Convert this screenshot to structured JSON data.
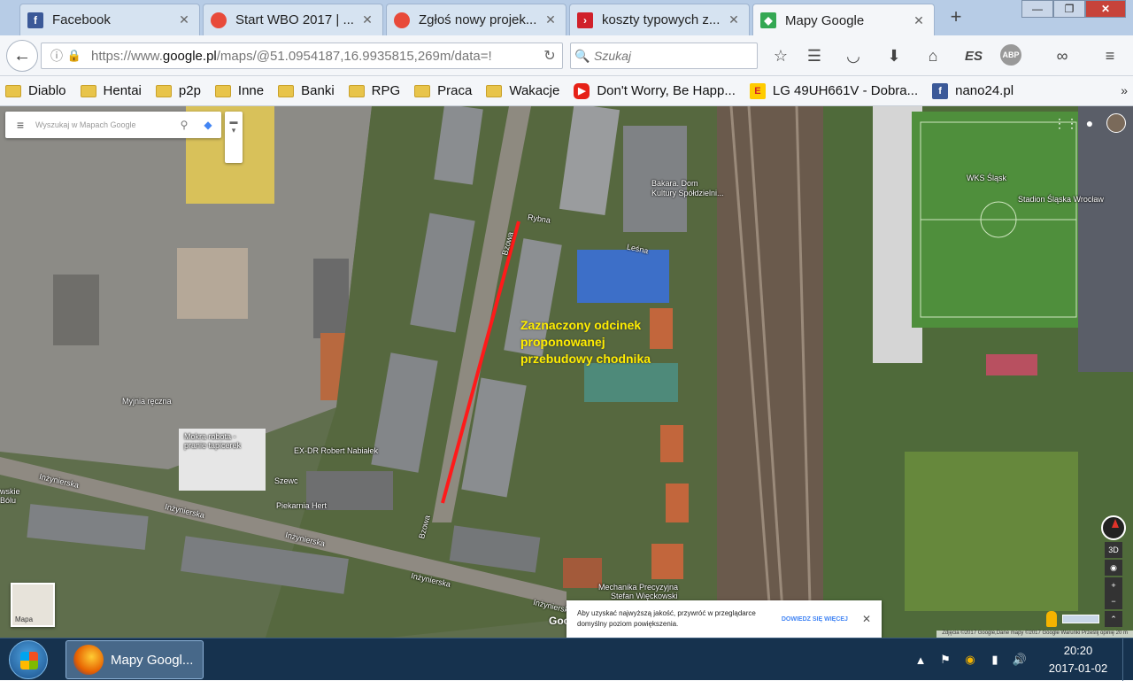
{
  "browser": {
    "tabs": [
      {
        "title": "Facebook",
        "icon": "facebook-icon",
        "color": "#3b5998"
      },
      {
        "title": "Start WBO 2017 | ...",
        "icon": "wbo-icon",
        "color": "#e84a3a"
      },
      {
        "title": "Zgłoś nowy projek...",
        "icon": "wbo-icon",
        "color": "#e84a3a"
      },
      {
        "title": "koszty typowych z...",
        "icon": "play-icon",
        "color": "#d0202a"
      },
      {
        "title": "Mapy Google",
        "icon": "google-maps-icon",
        "color": "#34a853"
      }
    ],
    "close_glyph": "✕",
    "new_tab_glyph": "+",
    "window": {
      "minimize": "—",
      "maximize": "❐",
      "close": "✕"
    },
    "url_prefix": "https://www.",
    "url_domain": "google.pl",
    "url_rest": "/maps/@51.0954187,16.9935815,269m/data=!",
    "search_placeholder": "Szukaj",
    "toolbar_extension_label": "ES",
    "adblock_label": "ABP"
  },
  "bookmarks": [
    {
      "label": "Diablo",
      "type": "folder"
    },
    {
      "label": "Hentai",
      "type": "folder"
    },
    {
      "label": "p2p",
      "type": "folder"
    },
    {
      "label": "Inne",
      "type": "folder"
    },
    {
      "label": "Banki",
      "type": "folder"
    },
    {
      "label": "RPG",
      "type": "folder"
    },
    {
      "label": "Praca",
      "type": "folder"
    },
    {
      "label": "Wakacje",
      "type": "folder"
    },
    {
      "label": "Don't Worry, Be Happ...",
      "type": "youtube",
      "color": "#e62117"
    },
    {
      "label": "LG 49UH661V - Dobra...",
      "type": "euro",
      "color": "#ffcc00"
    },
    {
      "label": "nano24.pl",
      "type": "facebook",
      "color": "#3b5998"
    }
  ],
  "bookmarks_more": "»",
  "map": {
    "search_placeholder": "Wyszukaj w Mapach Google",
    "annotation": [
      "Zaznaczony odcinek",
      "proponowanej",
      "przebudowy chodnika"
    ],
    "highlight_color": "#ff1a1a",
    "annotation_color": "#ffee00",
    "labels": {
      "bakara": "Bakara. Dom",
      "bakara2": "Kultury Spółdzielni...",
      "wks": "WKS Śląsk",
      "stadion": "Stadion Śląska Wrocław",
      "myjnia": "Myjnia ręczna",
      "mokra": "Mokra robota -",
      "mokra2": "pranie tapicerek",
      "exdr": "EX-DR Robert Nabiałek",
      "szewc": "Szewc",
      "piekarnia": "Piekarnia Hert",
      "inzynierska1": "Inżynierska",
      "inzynierska2": "Inżynierska",
      "inzynierska3": "Inżynierska",
      "inzynierska4": "Inżynierska",
      "inzynierska5": "Inżynierska",
      "mechanika": "Mechanika Precyzyjna",
      "mechanika2": "Stefan Więckowski",
      "street_rybna": "Rybna",
      "street_bzowa": "Bzowa",
      "street_lesna": "Leśna",
      "street_bzowa2": "Bzowa",
      "left_edge1": "wskie",
      "left_edge2": "Bólu"
    },
    "minimap_label": "Mapa",
    "controls": {
      "three_d": "3D",
      "zoom_in": "+",
      "zoom_out": "−",
      "collapse": "⌃"
    },
    "google_stamp": "Google",
    "attribution": "Zdjęcia ©2017 Google,Dane mapy ©2017 Google    Warunki    Prześlij opinię    20 m",
    "snackbar": {
      "message": "Aby uzyskać najwyższą jakość, przywróć w przeglądarce domyślny poziom powiększenia.",
      "action": "DOWIEDZ SIĘ WIĘCEJ",
      "close": "✕"
    }
  },
  "taskbar": {
    "app_label": "Mapy Googl...",
    "time": "20:20",
    "date": "2017-01-02"
  }
}
